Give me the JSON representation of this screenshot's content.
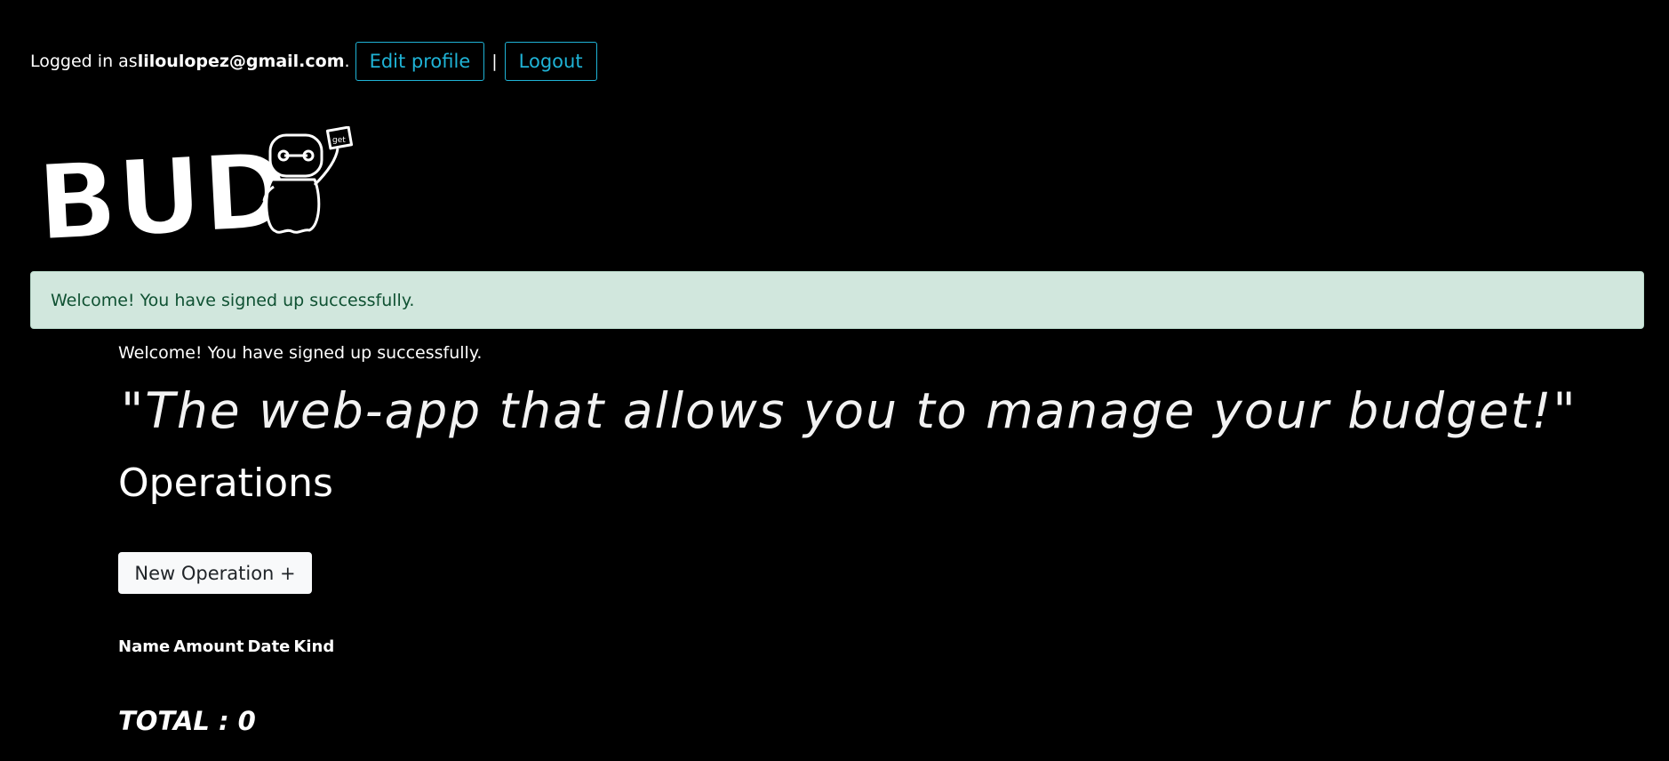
{
  "header": {
    "logged_in_prefix": "Logged in as ",
    "email": "liloulopez@gmail.com",
    "email_suffix": ".",
    "edit_profile_label": "Edit profile",
    "separator": "|",
    "logout_label": "Logout"
  },
  "logo": {
    "text": "BUD",
    "badge_text": "get"
  },
  "flash": {
    "alert_message": "Welcome! You have signed up successfully.",
    "notice_message": "Welcome! You have signed up successfully."
  },
  "main": {
    "tagline": "\"The web-app that allows you to manage your budget!\"",
    "heading": "Operations",
    "new_operation_label": "New Operation +",
    "table_headers": [
      "Name",
      "Amount",
      "Date",
      "Kind"
    ],
    "total_label": "TOTAL : 0"
  },
  "colors": {
    "background": "#000000",
    "accent": "#1fb3d6",
    "alert_bg": "#d1e7dd",
    "alert_text": "#0f5132"
  }
}
